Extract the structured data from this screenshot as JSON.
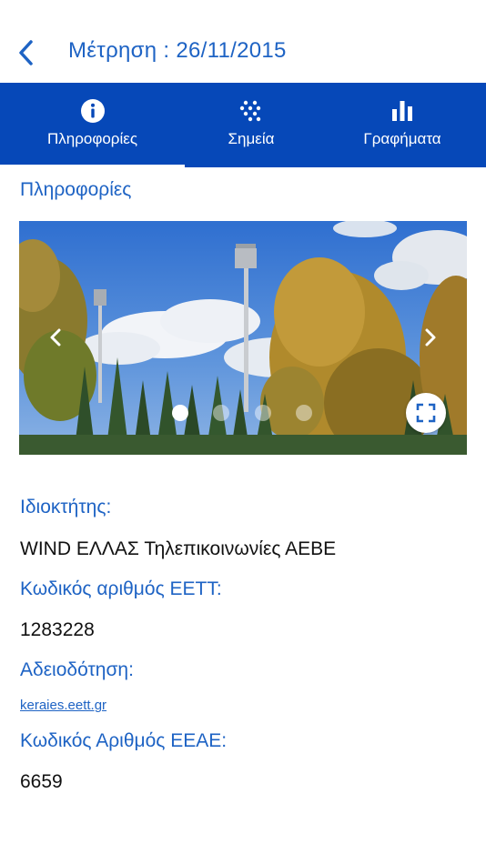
{
  "header": {
    "title": "Μέτρηση : 26/11/2015",
    "back_icon": "chevron-left-icon"
  },
  "colors": {
    "accent": "#1e63c4",
    "tabbar": "#0648b8",
    "text": "#111111"
  },
  "tabs": [
    {
      "label": "Πληροφορίες",
      "icon": "info-icon",
      "active": true
    },
    {
      "label": "Σημεία",
      "icon": "dots-grid-icon",
      "active": false
    },
    {
      "label": "Γραφήματα",
      "icon": "bar-chart-icon",
      "active": false
    }
  ],
  "section": {
    "title": "Πληροφορίες"
  },
  "carousel": {
    "slide_count": 4,
    "active_slide": 1,
    "prev_icon": "chevron-left-icon",
    "next_icon": "chevron-right-icon",
    "fullscreen_icon": "fullscreen-icon"
  },
  "details": {
    "owner_label": "Ιδιοκτήτης:",
    "owner_value": "WIND ΕΛΛΑΣ Τηλεπικοινωνίες ΑΕΒΕ",
    "eett_code_label": "Κωδικός αριθμός ΕΕΤΤ:",
    "eett_code_value": "1283228",
    "licensing_label": "Αδειοδότηση:",
    "licensing_link": "keraies.eett.gr",
    "eeae_code_label": "Κωδικός Αριθμός ΕΕΑΕ:",
    "eeae_code_value": "6659"
  }
}
